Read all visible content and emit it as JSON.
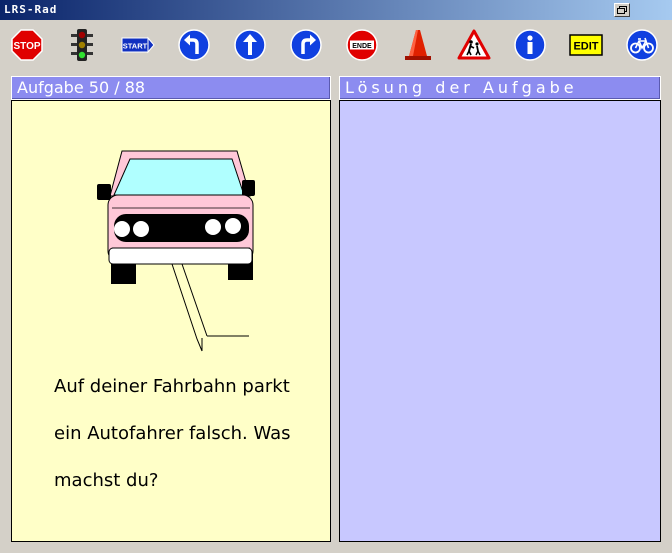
{
  "window": {
    "title": "LRS-Rad"
  },
  "toolbar": {
    "items": [
      {
        "name": "stop-button",
        "icon": "stop-sign-icon",
        "label": "STOP"
      },
      {
        "name": "traffic-light-button",
        "icon": "traffic-light-icon"
      },
      {
        "name": "start-button",
        "icon": "start-sign-icon",
        "label": "START"
      },
      {
        "name": "turn-left-button",
        "icon": "arrow-turn-left-icon"
      },
      {
        "name": "straight-button",
        "icon": "arrow-up-icon"
      },
      {
        "name": "turn-right-button",
        "icon": "arrow-turn-right-icon"
      },
      {
        "name": "end-button",
        "icon": "end-sign-icon",
        "label": "ENDE"
      },
      {
        "name": "cone-button",
        "icon": "traffic-cone-icon"
      },
      {
        "name": "warning-button",
        "icon": "children-warning-sign-icon"
      },
      {
        "name": "info-button",
        "icon": "info-icon"
      },
      {
        "name": "edit-button",
        "icon": "edit-icon",
        "label": "EDIT"
      },
      {
        "name": "bicycle-button",
        "icon": "bicycle-sign-icon"
      }
    ]
  },
  "task": {
    "header": "Aufgabe 50 / 88",
    "question": "Auf deiner Fahrbahn parkt\nein Autofahrer falsch. Was\nmachst du?"
  },
  "solution": {
    "header": "Lösung der Aufgabe"
  },
  "colors": {
    "task_panel_bg": "#ffffc8",
    "solution_panel_bg": "#c8c8ff",
    "header_bg": "#8c8cf0"
  }
}
